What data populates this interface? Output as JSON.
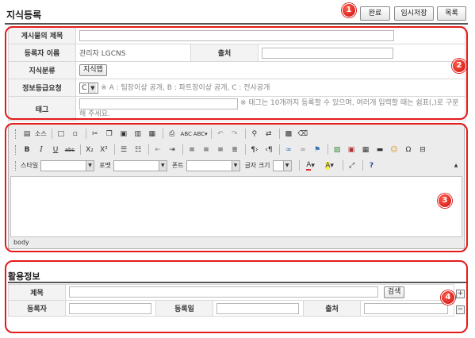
{
  "page": {
    "title": "지식등록",
    "buttons": {
      "complete": "완료",
      "temp_save": "임시저장",
      "list": "목록"
    }
  },
  "callouts": [
    "1",
    "2",
    "3",
    "4"
  ],
  "form": {
    "subject_label": "게시물의 제목",
    "subject_value": "",
    "author_label": "등록자 이름",
    "author_value": "관리자 LGCNS",
    "source_label": "출처",
    "source_value": "",
    "category_label": "지식분류",
    "category_button": "지식맵",
    "security_label": "정보등급요청",
    "security_selected": "C",
    "security_note": "※ A : 팀장이상 공개, B : 파트장이상 공개, C : 전사공개",
    "tag_label": "태그",
    "tag_value": "",
    "tag_note": "※ 태그는 10개까지 등록할 수 있으며, 여러개 입력할 때는 쉼표(,)로 구분해 주세요."
  },
  "editor": {
    "source_label": "소스",
    "style_label": "스타일",
    "format_label": "포맷",
    "font_label": "폰트",
    "size_label": "글자 크기",
    "status_path": "body",
    "row2_icons": [
      "bold-icon",
      "italic-icon",
      "underline-icon",
      "strike-icon",
      "subscript-icon",
      "superscript-icon",
      "ordered-list-icon",
      "bullet-list-icon",
      "outdent-icon",
      "indent-icon",
      "align-left-icon",
      "align-center-icon",
      "align-right-icon",
      "justify-icon",
      "ltr-icon",
      "rtl-icon",
      "link-icon",
      "unlink-icon",
      "anchor-icon",
      "image-icon",
      "flash-icon",
      "table-icon",
      "hr-icon",
      "smiley-icon",
      "special-char-icon",
      "page-break-icon"
    ]
  },
  "usage": {
    "title": "활용정보",
    "subject_label": "제목",
    "search_button": "검색",
    "registrant_label": "등록자",
    "date_label": "등록일",
    "source_label": "출처",
    "plus": "+",
    "minus": "−"
  }
}
